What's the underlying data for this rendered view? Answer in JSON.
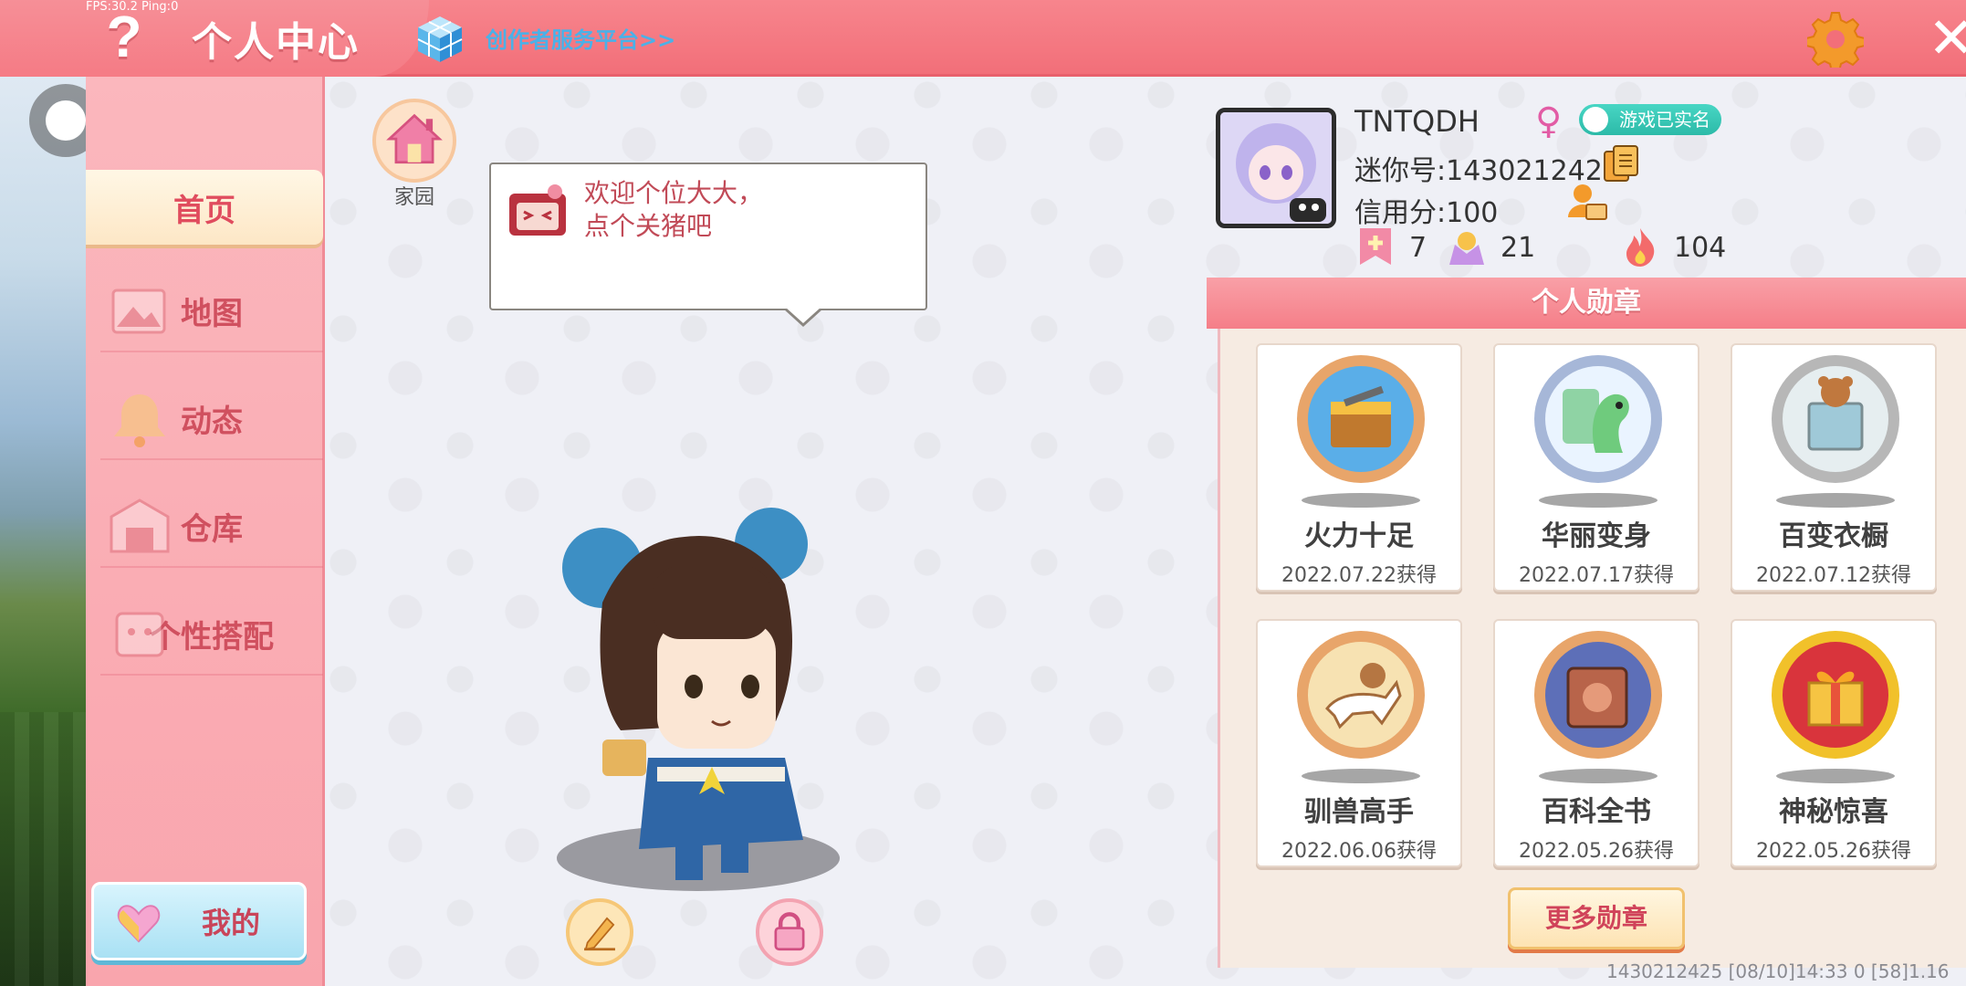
{
  "debug": {
    "fps_text": "FPS:30.2  Ping:0"
  },
  "header": {
    "title": "个人中心",
    "creator_link": "创作者服务平台>>",
    "help_icon": "question-mark-icon",
    "settings_icon": "gear-icon",
    "close_icon": "close-icon",
    "help_glyph": "?",
    "close_glyph": "✕"
  },
  "sidebar": {
    "items": [
      {
        "label": "首页",
        "active": true
      },
      {
        "label": "地图",
        "icon": "picture-icon"
      },
      {
        "label": "动态",
        "icon": "bell-icon"
      },
      {
        "label": "仓库",
        "icon": "warehouse-icon"
      },
      {
        "label": "个性搭配",
        "icon": "outfit-icon"
      }
    ],
    "my_button": "我的"
  },
  "center": {
    "home_label": "家园",
    "speech": "欢迎个位大大，\n点个关猪吧"
  },
  "profile": {
    "username": "TNTQDH",
    "gender_glyph": "♀",
    "verified_text": "游戏已实名",
    "mini_id": "迷你号:1430212425",
    "credit": "信用分:100",
    "stats": [
      {
        "icon": "badge-plus-icon",
        "value": "7"
      },
      {
        "icon": "fan-icon",
        "value": "21"
      },
      {
        "icon": "flame-icon",
        "value": "104"
      }
    ]
  },
  "medals": {
    "header": "个人勋章",
    "items": [
      {
        "name": "火力十足",
        "date": "2022.07.22获得",
        "ring": "#e8a56a",
        "fill": "#5aaee8"
      },
      {
        "name": "华丽变身",
        "date": "2022.07.17获得",
        "ring": "#a6b7d8",
        "fill": "#8fd3a4"
      },
      {
        "name": "百变衣橱",
        "date": "2022.07.12获得",
        "ring": "#b7b7b7",
        "fill": "#d8e4e8"
      },
      {
        "name": "驯兽高手",
        "date": "2022.06.06获得",
        "ring": "#e8a56a",
        "fill": "#f7e2b2"
      },
      {
        "name": "百科全书",
        "date": "2022.05.26获得",
        "ring": "#e8a56a",
        "fill": "#5d6fb8"
      },
      {
        "name": "神秘惊喜",
        "date": "2022.05.26获得",
        "ring": "#f1c12a",
        "fill": "#d9343c"
      }
    ],
    "more_button": "更多勋章"
  },
  "footer": {
    "info": "1430212425   [08/10]14:33 0   [58]1.16"
  },
  "colors": {
    "top_bar": "#f26f79",
    "sidebar": "#f9a5ad",
    "accent_text": "#d0505f",
    "link": "#4ab1e8"
  }
}
